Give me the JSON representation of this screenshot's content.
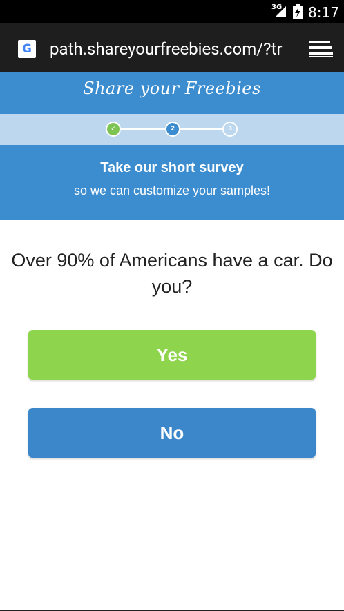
{
  "status_bar": {
    "network": "3G",
    "time": "8:17",
    "signal_icon": "signal-icon",
    "battery_icon": "battery-charging-icon"
  },
  "browser": {
    "favicon_letter": "G",
    "url": "path.shareyourfreebies.com/?tr",
    "tabs_icon": "tabs-icon"
  },
  "header": {
    "logo_text": "Share your Freebies"
  },
  "progress": {
    "steps": [
      {
        "label": "✓",
        "state": "done"
      },
      {
        "label": "2",
        "state": "active"
      },
      {
        "label": "3",
        "state": "todo"
      }
    ],
    "current_step": 2,
    "total_steps": 3
  },
  "survey": {
    "title": "Take our short survey",
    "subtitle": "so we can customize your samples!"
  },
  "question": {
    "text": "Over 90% of Americans have a car. Do you?"
  },
  "answers": {
    "yes_label": "Yes",
    "no_label": "No"
  },
  "colors": {
    "brand_blue": "#3c8dcf",
    "progress_band": "#bcd7ee",
    "step_done": "#7dc452",
    "yes_green": "#8fd44d",
    "no_blue": "#3c87c9"
  }
}
